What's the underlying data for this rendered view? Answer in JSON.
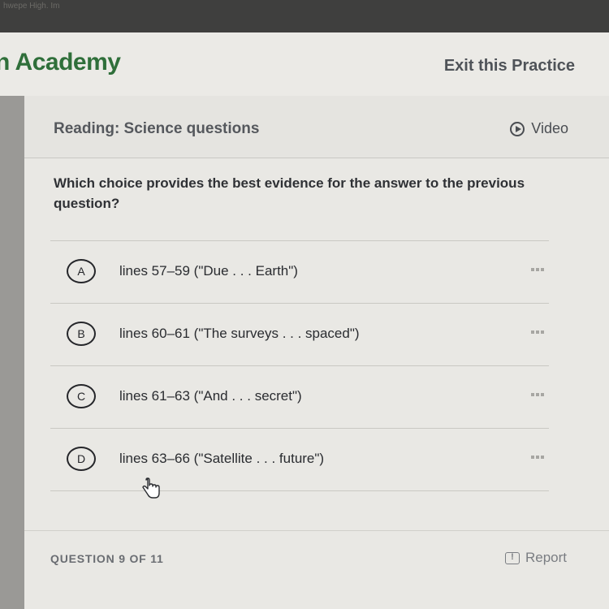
{
  "browser": {
    "faint_text": "hwepe High. Im"
  },
  "header": {
    "brand": "n Academy",
    "exit_label": "Exit this Practice"
  },
  "section": {
    "title": "Reading: Science questions",
    "video_label": "Video"
  },
  "question": {
    "text": "Which choice provides the best evidence for the answer to the previous question?"
  },
  "choices": [
    {
      "letter": "A",
      "text": "lines 57–59 (\"Due . . . Earth\")"
    },
    {
      "letter": "B",
      "text": "lines 60–61 (\"The surveys . . . spaced\")"
    },
    {
      "letter": "C",
      "text": "lines 61–63 (\"And . . . secret\")"
    },
    {
      "letter": "D",
      "text": "lines 63–66 (\"Satellite . . . future\")"
    }
  ],
  "footer": {
    "question_count": "QUESTION 9 OF 11",
    "report_label": "Report"
  },
  "colors": {
    "brand_green": "#2f6f3a",
    "text_dark": "#2f3135",
    "muted": "#7a7d82"
  }
}
